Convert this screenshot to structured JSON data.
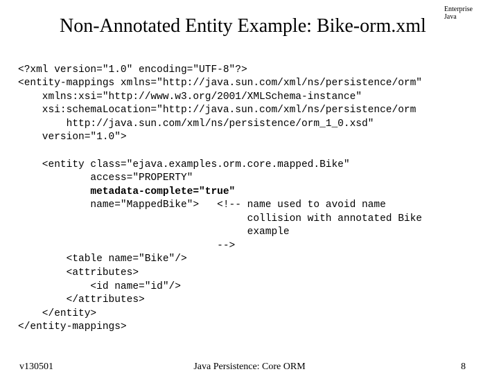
{
  "header": {
    "tag_line1": "Enterprise",
    "tag_line2": "Java",
    "title": "Non-Annotated Entity Example: Bike-orm.xml"
  },
  "code": {
    "l01": "<?xml version=\"1.0\" encoding=\"UTF-8\"?>",
    "l02": "<entity-mappings xmlns=\"http://java.sun.com/xml/ns/persistence/orm\"",
    "l03": "    xmlns:xsi=\"http://www.w3.org/2001/XMLSchema-instance\"",
    "l04": "    xsi:schemaLocation=\"http://java.sun.com/xml/ns/persistence/orm",
    "l05": "        http://java.sun.com/xml/ns/persistence/orm_1_0.xsd\"",
    "l06": "    version=\"1.0\">",
    "l07": "",
    "l08": "    <entity class=\"ejava.examples.orm.core.mapped.Bike\"",
    "l09": "            access=\"PROPERTY\"",
    "l10a": "            ",
    "l10b": "metadata-complete=\"true\"",
    "l11": "            name=\"MappedBike\">   <!-- name used to avoid name",
    "l12": "                                      collision with annotated Bike",
    "l13": "                                      example",
    "l14": "                                 -->",
    "l15": "        <table name=\"Bike\"/>",
    "l16": "        <attributes>",
    "l17": "            <id name=\"id\"/>",
    "l18": "        </attributes>",
    "l19": "    </entity>",
    "l20": "</entity-mappings>"
  },
  "footer": {
    "left": "v130501",
    "center": "Java Persistence: Core ORM",
    "right": "8"
  }
}
